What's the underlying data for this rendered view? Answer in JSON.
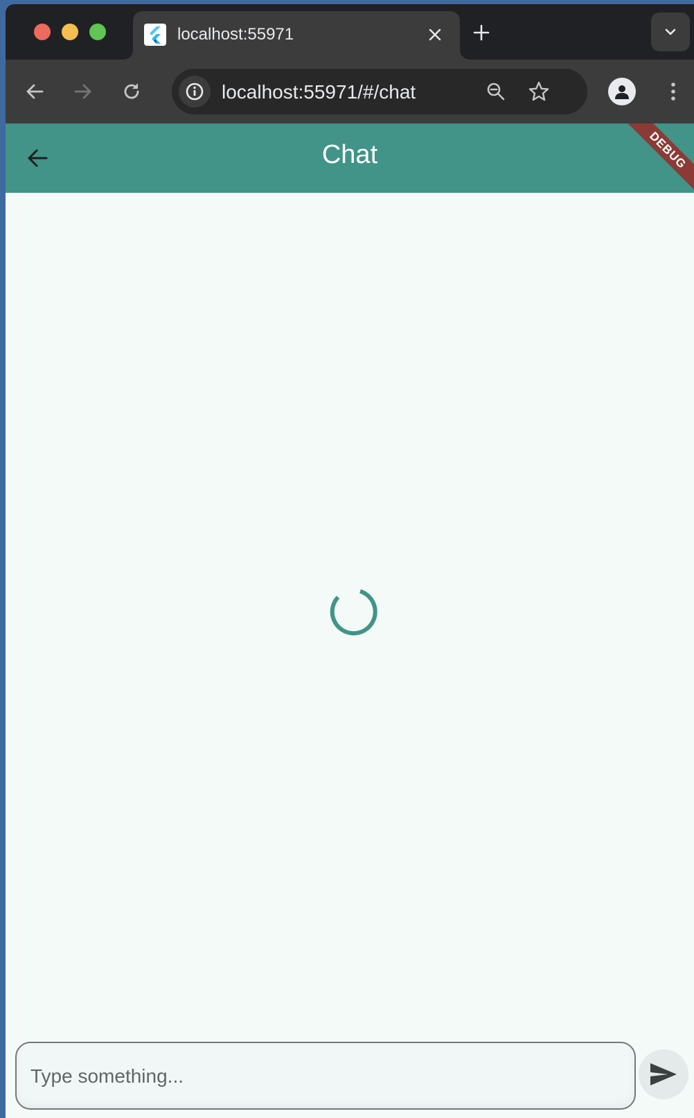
{
  "browser": {
    "tab": {
      "title": "localhost:55971",
      "favicon": "flutter-icon"
    },
    "address_bar": {
      "url": "localhost:55971/#/chat"
    },
    "icons": {
      "close_tab": "close-icon",
      "new_tab": "plus-icon",
      "tab_search": "chevron-down-icon",
      "back": "arrow-left-icon",
      "forward": "arrow-right-icon",
      "reload": "reload-icon",
      "site_info": "info-icon",
      "zoom": "zoom-out-icon",
      "bookmark": "star-icon",
      "profile": "person-icon",
      "menu": "kebab-menu-icon"
    }
  },
  "app": {
    "title": "Chat",
    "debug_banner": "DEBUG",
    "accent_color": "#429388",
    "loading": true,
    "composer": {
      "placeholder": "Type something...",
      "value": ""
    }
  }
}
